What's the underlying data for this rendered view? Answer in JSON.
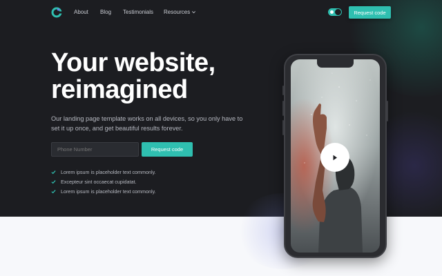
{
  "nav": {
    "items": [
      {
        "label": "About"
      },
      {
        "label": "Blog"
      },
      {
        "label": "Testimonials"
      },
      {
        "label": "Resources"
      }
    ],
    "cta_label": "Request code"
  },
  "hero": {
    "title_line1": "Your website,",
    "title_line2": "reimagined",
    "subtitle": "Our landing page template works on all devices, so you only have to set it up once, and get beautiful results forever.",
    "phone_placeholder": "Phone Number",
    "cta_label": "Request code",
    "checks": [
      {
        "text": "Lorem ipsum is placeholder text commonly."
      },
      {
        "text": "Excepteur sint occaecat cupidatat."
      },
      {
        "text": "Lorem ipsum is placeholder text commonly."
      }
    ]
  },
  "icons": {
    "logo": "logo-icon",
    "chevron": "chevron-down-icon",
    "check": "check-icon",
    "play": "play-icon",
    "theme_toggle": "theme-toggle"
  },
  "colors": {
    "accent": "#2fbfb0",
    "background_dark": "#1c1d21",
    "background_light": "#f7f8fb"
  }
}
